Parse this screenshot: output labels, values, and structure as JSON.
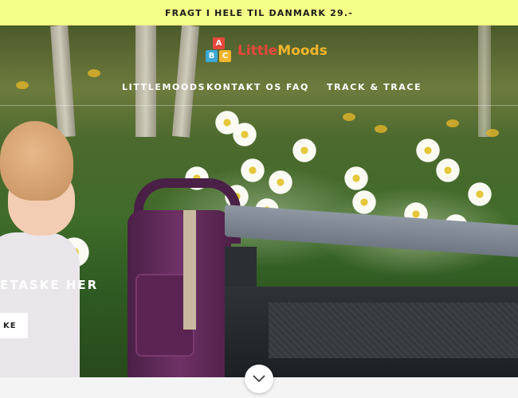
{
  "announcement": {
    "text": "FRAGT I HELE TIL DANMARK 29.-"
  },
  "logo": {
    "blocks": [
      "A",
      "B",
      "C"
    ],
    "text_parts": [
      {
        "text": "Little",
        "color": "#e8473c"
      },
      {
        "text": "Moods",
        "color": "#f2b52c"
      }
    ]
  },
  "nav": {
    "items": [
      {
        "label": "LITTLEMOODS"
      },
      {
        "label": "KONTAKT OS"
      },
      {
        "label": "FAQ"
      },
      {
        "label": "TRACK & TRACE"
      }
    ]
  },
  "hero": {
    "headline": "ETASKE HER",
    "button_label": "KE"
  },
  "colors": {
    "announcement_bg": "#f3ff86",
    "block_a": "#e8473c",
    "block_b": "#3aa8d8",
    "block_c": "#f2b52c"
  },
  "icons": {
    "scroll": "chevron-down-icon"
  }
}
